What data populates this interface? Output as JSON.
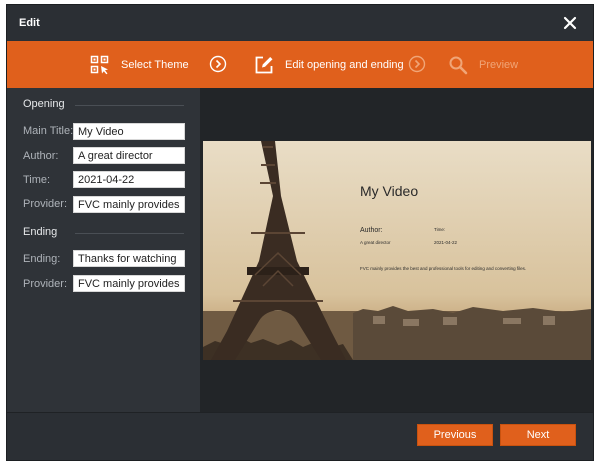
{
  "window": {
    "title": "Edit"
  },
  "steps": [
    {
      "label": "Select Theme",
      "icon": "select-theme-icon",
      "state": "done"
    },
    {
      "label": "Edit opening and ending",
      "icon": "edit-icon",
      "state": "active"
    },
    {
      "label": "Preview",
      "icon": "search-icon",
      "state": "disabled"
    }
  ],
  "opening": {
    "heading": "Opening",
    "fields": [
      {
        "label": "Main Title:",
        "value": "My Video"
      },
      {
        "label": "Author:",
        "value": "A great director"
      },
      {
        "label": "Time:",
        "value": "2021-04-22"
      },
      {
        "label": "Provider:",
        "value": "FVC mainly provides the"
      }
    ]
  },
  "ending": {
    "heading": "Ending",
    "fields": [
      {
        "label": "Ending:",
        "value": "Thanks for watching"
      },
      {
        "label": "Provider:",
        "value": "FVC mainly provides the"
      }
    ]
  },
  "preview": {
    "title": "My Video",
    "author_label": "Author:",
    "author_value": "A great director",
    "time_label": "Time:",
    "time_value": "2021-04-22",
    "provider_text": "FVC mainly provides the best and professional tools for editing and converting files."
  },
  "footer": {
    "previous_label": "Previous",
    "next_label": "Next"
  },
  "colors": {
    "accent": "#e0601c",
    "panel": "#2f3338",
    "preview_bg": "#222528"
  }
}
